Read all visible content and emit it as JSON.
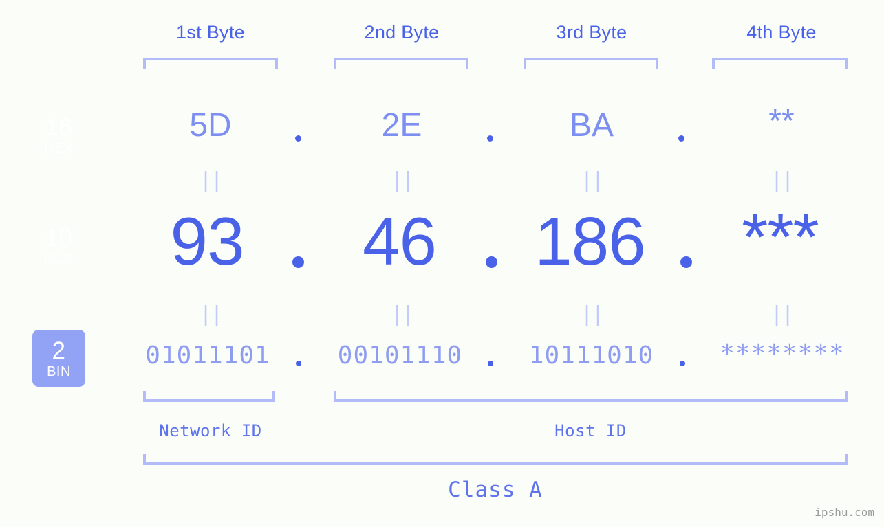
{
  "page": {
    "background_color": "#fbfdf8",
    "accent_color": "#4a62e8",
    "light_accent_color": "#b3bcf9",
    "muted_accent_color": "#7d8ff0",
    "watermark": "ipshu.com"
  },
  "byte_headers": [
    {
      "label": "1st Byte"
    },
    {
      "label": "2nd Byte"
    },
    {
      "label": "3rd Byte"
    },
    {
      "label": "4th Byte"
    }
  ],
  "bases": [
    {
      "number": "16",
      "name": "HEX",
      "badge_color": "#7183ee"
    },
    {
      "number": "10",
      "name": "DEC",
      "badge_color": "#7183ee"
    },
    {
      "number": "2",
      "name": "BIN",
      "badge_color": "#92a2f4"
    }
  ],
  "rows": {
    "hex": {
      "values": [
        "5D",
        "2E",
        "BA",
        "**"
      ],
      "separator": "."
    },
    "dec": {
      "values": [
        "93",
        "46",
        "186",
        "***"
      ],
      "separator": "."
    },
    "bin": {
      "values": [
        "01011101",
        "00101110",
        "10111010",
        "********"
      ],
      "separator": "."
    }
  },
  "equals_marks": {
    "glyph": "||",
    "count_per_row": 4,
    "rows": 2
  },
  "id_labels": {
    "network": "Network ID",
    "host": "Host ID"
  },
  "class_label": "Class A"
}
